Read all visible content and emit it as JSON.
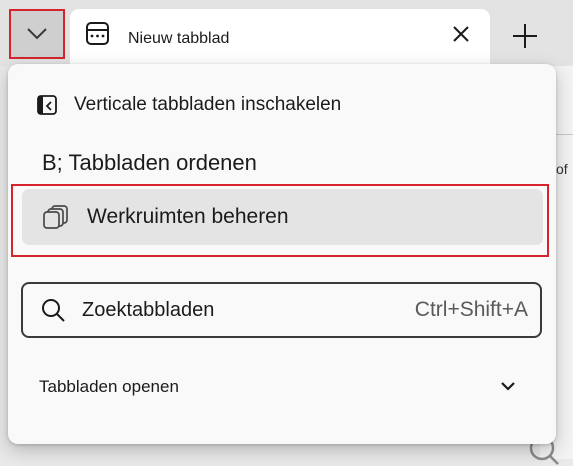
{
  "tab_strip": {
    "tab_actions_button": "tab-actions-chevron",
    "active_tab": {
      "title": "Nieuw tabblad",
      "favicon": "new-tab-page-icon"
    },
    "new_tab_icon": "plus-icon"
  },
  "background": {
    "fragment_text": "of"
  },
  "menu": {
    "vertical_tabs_label": "Verticale tabbladen inschakelen",
    "organize_tabs_label": "B; Tabbladen ordenen",
    "workspaces_label": "Werkruimten beheren",
    "search": {
      "placeholder": "Zoektabbladen",
      "value": "",
      "shortcut": "Ctrl+Shift+A"
    },
    "open_tabs_label": "Tabbladen openen"
  },
  "colors": {
    "highlight_border": "#d6232c",
    "menu_background": "#f9f9f9",
    "selected_item_background": "#e4e4e4",
    "tab_strip_background": "#e3e3e3"
  }
}
